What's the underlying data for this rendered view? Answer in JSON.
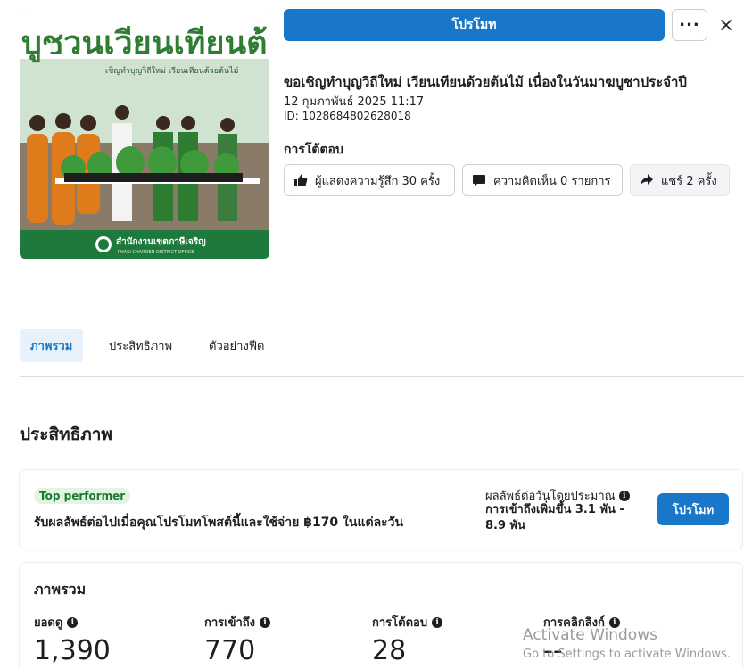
{
  "header": {
    "promote_label": "โปรโมท",
    "more_icon": "more-horizontal-icon",
    "close_icon": "close-icon"
  },
  "thumbnail": {
    "banner_text": "บูชวนเวียนเทียนต้นไ",
    "banner_subtitle": "เชิญทำบุญวิถีใหม่ เวียนเทียนด้วยต้นไม้",
    "footer_text": "สำนักงานเขตภาษีเจริญ",
    "footer_subtext": "PHASI CHAROEN DISTRICT OFFICE"
  },
  "post": {
    "title": "ขอเชิญทำบุญวิถีใหม่ เวียนเทียนด้วยต้นไม้ เนื่องในวันมาฆบูชาประจำปี",
    "date": "12 กุมภาพันธ์ 2025 11:17",
    "id": "ID: 1028684802628018"
  },
  "interactions": {
    "heading": "การโต้ตอบ",
    "reactions_label": "ผู้แสดงความรู้สึก 30 ครั้ง",
    "comments_label": "ความคิดเห็น 0 รายการ",
    "shares_label": "แชร์ 2 ครั้ง"
  },
  "tabs": [
    {
      "label": "ภาพรวม",
      "active": true
    },
    {
      "label": "ประสิทธิภาพ",
      "active": false
    },
    {
      "label": "ตัวอย่างฟีด",
      "active": false
    }
  ],
  "performance": {
    "section_title": "ประสิทธิภาพ",
    "badge": "Top performer",
    "message": "รับผลลัพธ์ต่อไปเมื่อคุณโปรโมทโพสต์นี้และใช้จ่าย ฿170 ในแต่ละวัน",
    "estimate_label": "ผลลัพธ์ต่อวันโดยประมาณ",
    "estimate_value": "การเข้าถึงเพิ่มขึ้น 3.1 พัน - 8.9 พัน",
    "promote_label": "โปรโมท"
  },
  "overview": {
    "title": "ภาพรวม",
    "metrics": [
      {
        "label": "ยอดดู",
        "value": "1,390"
      },
      {
        "label": "การเข้าถึง",
        "value": "770"
      },
      {
        "label": "การโต้ตอบ",
        "value": "28"
      },
      {
        "label": "การคลิกลิงก์",
        "value": "--"
      }
    ]
  },
  "watermark": {
    "line1": "Activate Windows",
    "line2": "Go to Settings to activate Windows."
  },
  "colors": {
    "primary": "#1877c8",
    "badge_bg": "#e3f4e3",
    "badge_text": "#1b7a2e",
    "tab_active_bg": "#e7f1fb"
  }
}
